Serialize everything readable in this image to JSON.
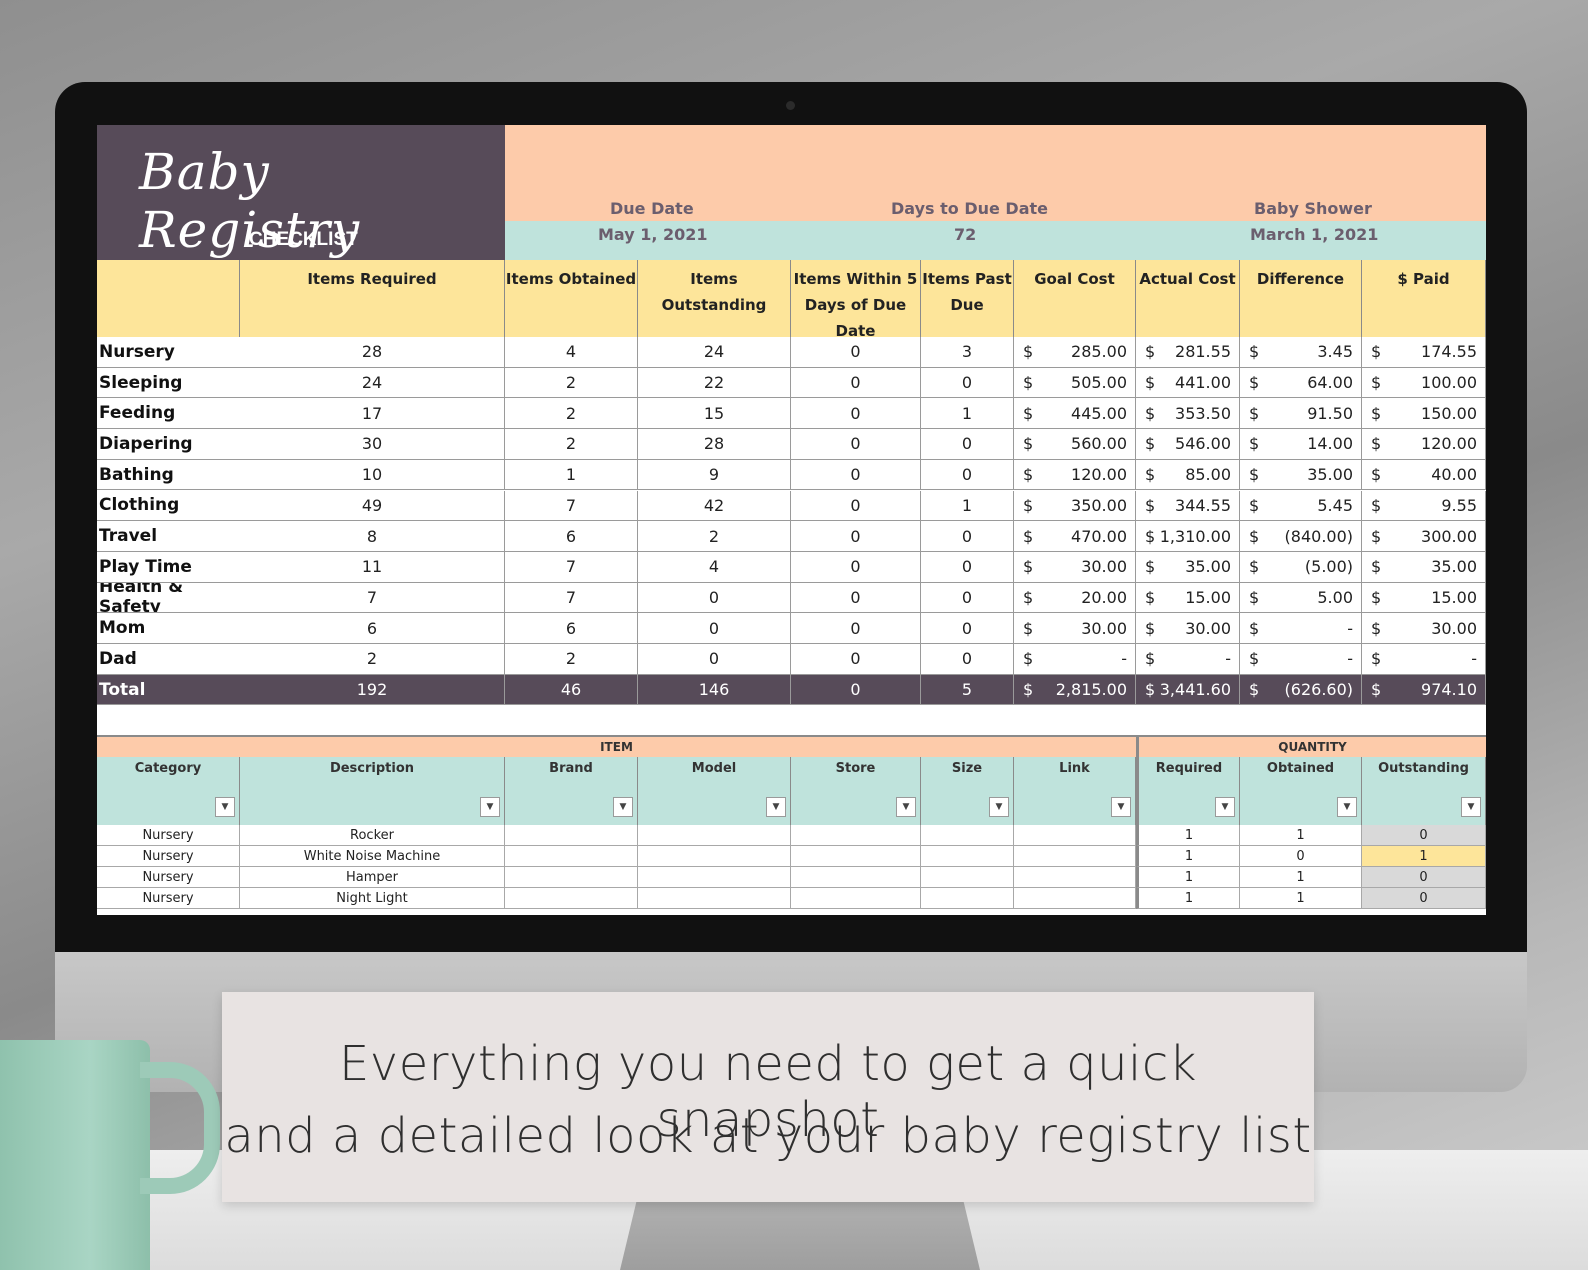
{
  "header": {
    "title": "Baby Registry",
    "subtitle": "CHECKLIST",
    "due_date_label": "Due Date",
    "due_date_value": "May 1, 2021",
    "days_to_due_label": "Days to Due Date",
    "days_to_due_value": "72",
    "shower_label": "Baby Shower",
    "shower_value": "March 1, 2021"
  },
  "summary": {
    "columns": {
      "required": "Items Required",
      "obtained": "Items Obtained",
      "outstanding": "Items Outstanding",
      "within5": "Items Within 5 Days of Due Date",
      "pastdue": "Items Past Due",
      "goal": "Goal Cost",
      "actual": "Actual Cost",
      "diff": "Difference",
      "paid": "$ Paid"
    },
    "currency": "$",
    "rows": [
      {
        "label": "Nursery",
        "required": "28",
        "obtained": "4",
        "outstanding": "24",
        "within5": "0",
        "pastdue": "3",
        "goal": "285.00",
        "actual": "281.55",
        "diff": "3.45",
        "paid": "174.55"
      },
      {
        "label": "Sleeping",
        "required": "24",
        "obtained": "2",
        "outstanding": "22",
        "within5": "0",
        "pastdue": "0",
        "goal": "505.00",
        "actual": "441.00",
        "diff": "64.00",
        "paid": "100.00"
      },
      {
        "label": "Feeding",
        "required": "17",
        "obtained": "2",
        "outstanding": "15",
        "within5": "0",
        "pastdue": "1",
        "goal": "445.00",
        "actual": "353.50",
        "diff": "91.50",
        "paid": "150.00"
      },
      {
        "label": "Diapering",
        "required": "30",
        "obtained": "2",
        "outstanding": "28",
        "within5": "0",
        "pastdue": "0",
        "goal": "560.00",
        "actual": "546.00",
        "diff": "14.00",
        "paid": "120.00"
      },
      {
        "label": "Bathing",
        "required": "10",
        "obtained": "1",
        "outstanding": "9",
        "within5": "0",
        "pastdue": "0",
        "goal": "120.00",
        "actual": "85.00",
        "diff": "35.00",
        "paid": "40.00"
      },
      {
        "label": "Clothing",
        "required": "49",
        "obtained": "7",
        "outstanding": "42",
        "within5": "0",
        "pastdue": "1",
        "goal": "350.00",
        "actual": "344.55",
        "diff": "5.45",
        "paid": "9.55"
      },
      {
        "label": "Travel",
        "required": "8",
        "obtained": "6",
        "outstanding": "2",
        "within5": "0",
        "pastdue": "0",
        "goal": "470.00",
        "actual": "1,310.00",
        "diff": "(840.00)",
        "paid": "300.00"
      },
      {
        "label": "Play Time",
        "required": "11",
        "obtained": "7",
        "outstanding": "4",
        "within5": "0",
        "pastdue": "0",
        "goal": "30.00",
        "actual": "35.00",
        "diff": "(5.00)",
        "paid": "35.00"
      },
      {
        "label": "Health & Safety",
        "required": "7",
        "obtained": "7",
        "outstanding": "0",
        "within5": "0",
        "pastdue": "0",
        "goal": "20.00",
        "actual": "15.00",
        "diff": "5.00",
        "paid": "15.00"
      },
      {
        "label": "Mom",
        "required": "6",
        "obtained": "6",
        "outstanding": "0",
        "within5": "0",
        "pastdue": "0",
        "goal": "30.00",
        "actual": "30.00",
        "diff": "-",
        "paid": "30.00"
      },
      {
        "label": "Dad",
        "required": "2",
        "obtained": "2",
        "outstanding": "0",
        "within5": "0",
        "pastdue": "0",
        "goal": "-",
        "actual": "-",
        "diff": "-",
        "paid": "-"
      }
    ],
    "total": {
      "label": "Total",
      "required": "192",
      "obtained": "46",
      "outstanding": "146",
      "within5": "0",
      "pastdue": "5",
      "goal": "2,815.00",
      "actual": "3,441.60",
      "diff": "(626.60)",
      "paid": "974.10"
    }
  },
  "detail": {
    "item_group_label": "ITEM",
    "quantity_group_label": "QUANTITY",
    "columns": {
      "category": "Category",
      "description": "Description",
      "brand": "Brand",
      "model": "Model",
      "store": "Store",
      "size": "Size",
      "link": "Link",
      "required": "Required",
      "obtained": "Obtained",
      "outstanding": "Outstanding"
    },
    "rows": [
      {
        "category": "Nursery",
        "description": "Rocker",
        "required": "1",
        "obtained": "1",
        "outstanding": "0"
      },
      {
        "category": "Nursery",
        "description": "White Noise Machine",
        "required": "1",
        "obtained": "0",
        "outstanding": "1"
      },
      {
        "category": "Nursery",
        "description": "Hamper",
        "required": "1",
        "obtained": "1",
        "outstanding": "0"
      },
      {
        "category": "Nursery",
        "description": "Night Light",
        "required": "1",
        "obtained": "1",
        "outstanding": "0"
      }
    ]
  },
  "caption": {
    "line1": "Everything you need to get a quick snapshot",
    "line2": "and a detailed look at your baby registry list"
  },
  "colors": {
    "title_bg": "#574b59",
    "peach": "#fdcbaa",
    "teal": "#bfe3dc",
    "header_yellow": "#fde59a",
    "highlight_yellow": "#fde59a",
    "outstanding_gray": "#d9d9d9"
  }
}
